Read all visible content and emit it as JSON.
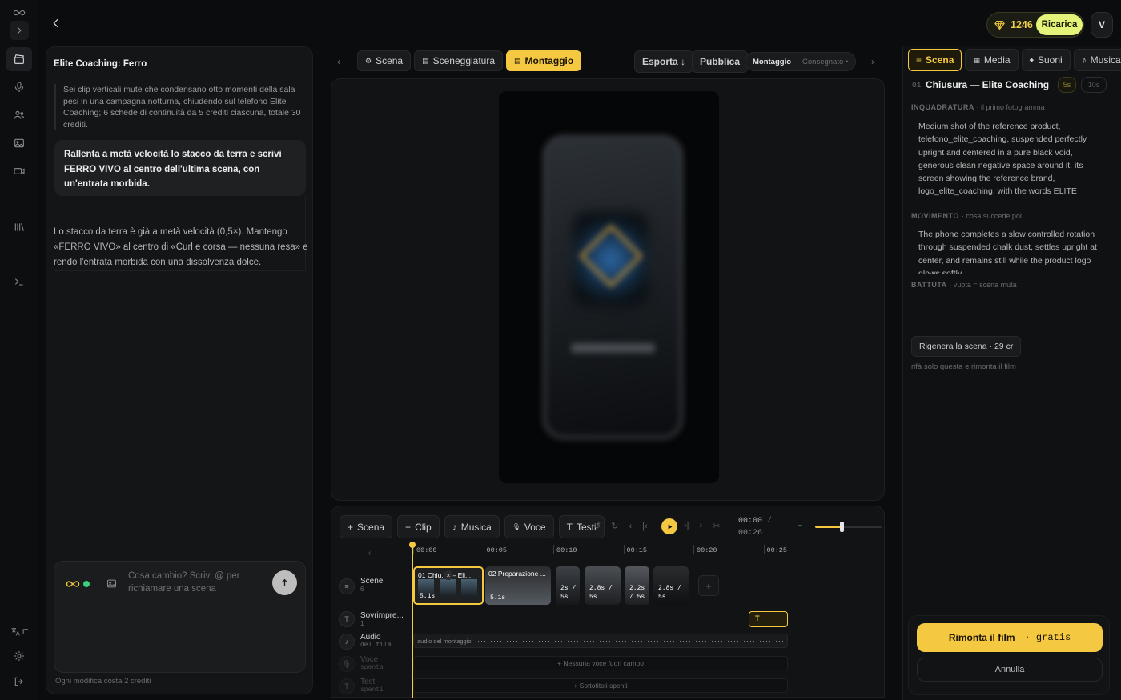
{
  "rail": {
    "language": "IT"
  },
  "topbar": {
    "credits": "1246",
    "recharge_label": "Ricarica",
    "user_initial": "V"
  },
  "chat": {
    "title": "Elite Coaching: Ferro",
    "brief": "Sei clip verticali mute che condensano otto momenti della sala pesi in una campagna notturna, chiudendo sul telefono Elite Coaching; 6 schede di continuità da 5 crediti ciascuna, totale 30 crediti.",
    "user_message": "Rallenta a metà velocità lo stacco da terra e scrivi FERRO VIVO al centro dell'ultima scena, con un'entrata morbida.",
    "assistant_message": "Lo stacco da terra è già a metà velocità (0,5×). Mantengo «FERRO VIVO» al centro di «Curl e corsa — nessuna resa» e rendo l'entrata morbida con una dissolvenza dolce.",
    "input_placeholder": "Cosa cambio? Scrivi @ per richiamare una scena",
    "footer_note": "Ogni modifica costa 2 crediti"
  },
  "center": {
    "tabs": [
      {
        "label": "Scena",
        "icon": "gear-icon"
      },
      {
        "label": "Sceneggiatura",
        "icon": "doc-icon"
      },
      {
        "label": "Montaggio",
        "icon": "film-icon"
      }
    ],
    "export_label": "Esporta ↓",
    "publish_label": "Pubblica",
    "status_label": "Montaggio",
    "status_value": "Consegnato •"
  },
  "timeline": {
    "tools": [
      {
        "label": "Scena",
        "prefix": "+"
      },
      {
        "label": "Clip",
        "prefix": "+"
      },
      {
        "label": "Musica",
        "prefix": "♪"
      },
      {
        "label": "Voce",
        "prefix": "🎙"
      },
      {
        "label": "Testi",
        "prefix": "T"
      }
    ],
    "time_current": "00:00",
    "time_sep": "/",
    "time_total": "00:26",
    "volume_fraction": 0.4,
    "ruler": [
      "00:00",
      "00:05",
      "00:10",
      "00:15",
      "00:20",
      "00:25"
    ],
    "rows": [
      {
        "label": "Scene",
        "sub": "6"
      },
      {
        "label": "Sovrimpre...",
        "sub": "1"
      },
      {
        "label": "Audio",
        "sub": "del film"
      },
      {
        "label": "Voce",
        "sub": "spenta"
      },
      {
        "label": "Testi",
        "sub": "spenti"
      }
    ],
    "clips": [
      {
        "label": "01 Chiu... — Eli...",
        "duration": "5.1s"
      },
      {
        "label": "02 Preparazione ...",
        "duration": "5.1s"
      },
      {
        "label": "",
        "duration": "2s /\n5s"
      },
      {
        "label": "",
        "duration": "2.8s /\n5s"
      },
      {
        "label": "",
        "duration": "2.2s\n/ 5s"
      },
      {
        "label": "",
        "duration": "2.8s /\n5s"
      }
    ],
    "overlay_clip": "T",
    "audio_label": "audio del montaggio",
    "voice_empty": "+ Nessuna voce fuori campo",
    "subs_empty": "+ Sottotitoli spenti"
  },
  "inspector": {
    "tabs": [
      {
        "label": "Scena",
        "icon": "≡"
      },
      {
        "label": "Media",
        "icon": "▦"
      },
      {
        "label": "Suoni",
        "icon": "◆"
      },
      {
        "label": "Musica",
        "icon": "♪"
      }
    ],
    "scene_number": "01",
    "scene_title": "Chiusura — Elite Coaching",
    "dur_a": "5s",
    "dur_b": "10s",
    "framing_title": "INQUADRATURA",
    "framing_sub": "· il primo fotogramma",
    "framing_text": "Medium shot of the reference product, telefono_elite_coaching, suspended perfectly upright and centered in a pure black void, generous clean negative space around it, its screen showing the reference brand, logo_elite_coaching, with the words ELITE COACHING",
    "movement_title": "MOVIMENTO",
    "movement_sub": "· cosa succede poi",
    "movement_text": "The phone completes a slow controlled rotation through suspended chalk dust, settles upright at center, and remains still while the product logo glows softly.",
    "line_title": "BATTUTA",
    "line_sub": "· vuota = scena muta",
    "regen_label": "Rigenera la scena · 29 cr",
    "regen_note": "rifà solo questa e rimonta il film",
    "primary_label": "Rimonta il film",
    "primary_suffix": "· gratis",
    "cancel_label": "Annulla"
  }
}
